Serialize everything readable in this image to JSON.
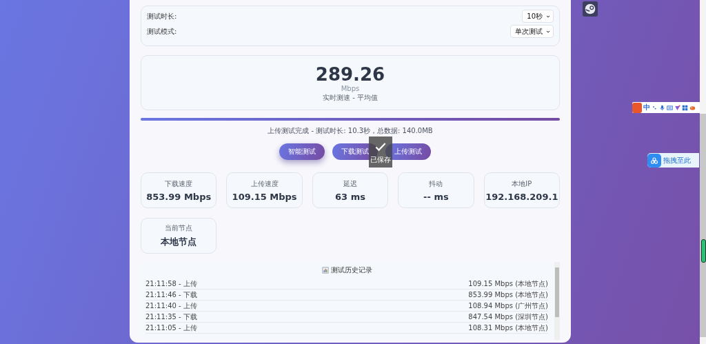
{
  "settings": [
    {
      "label": "测试时长:",
      "value": "10秒"
    },
    {
      "label": "测试模式:",
      "value": "单次测试"
    }
  ],
  "speed": {
    "value": "289.26",
    "unit": "Mbps",
    "caption": "实时测速 - 平均值"
  },
  "progress": {
    "level": 1
  },
  "status": "上传测试完成 - 测试时长: 10.3秒，总数据: 140.0MB",
  "buttons": [
    {
      "label": "智能测试",
      "selected": true
    },
    {
      "label": "下载测试",
      "selected": false
    },
    {
      "label": "上传测试",
      "selected": false
    }
  ],
  "toast": {
    "text": "已保存"
  },
  "stats": [
    {
      "label": "下载速度",
      "value": "853.99 Mbps"
    },
    {
      "label": "上传速度",
      "value": "109.15 Mbps"
    },
    {
      "label": "延迟",
      "value": "63 ms"
    },
    {
      "label": "抖动",
      "value": "-- ms"
    },
    {
      "label": "本地IP",
      "value": "192.168.209.1"
    },
    {
      "label": "当前节点",
      "value": "本地节点"
    }
  ],
  "history": {
    "title": "测试历史记录",
    "rows": [
      {
        "time": "21:11:58 - 上传",
        "result": "109.15 Mbps (本地节点)"
      },
      {
        "time": "21:11:46 - 下载",
        "result": "853.99 Mbps (本地节点)"
      },
      {
        "time": "21:11:40 - 上传",
        "result": "108.94 Mbps (广州节点)"
      },
      {
        "time": "21:11:35 - 下载",
        "result": "847.54 Mbps (深圳节点)"
      },
      {
        "time": "21:11:05 - 上传",
        "result": "108.31 Mbps (本地节点)"
      }
    ]
  },
  "ime_toolbar": {
    "mode": "中"
  },
  "drop_zone": {
    "text": "拖拽至此"
  }
}
